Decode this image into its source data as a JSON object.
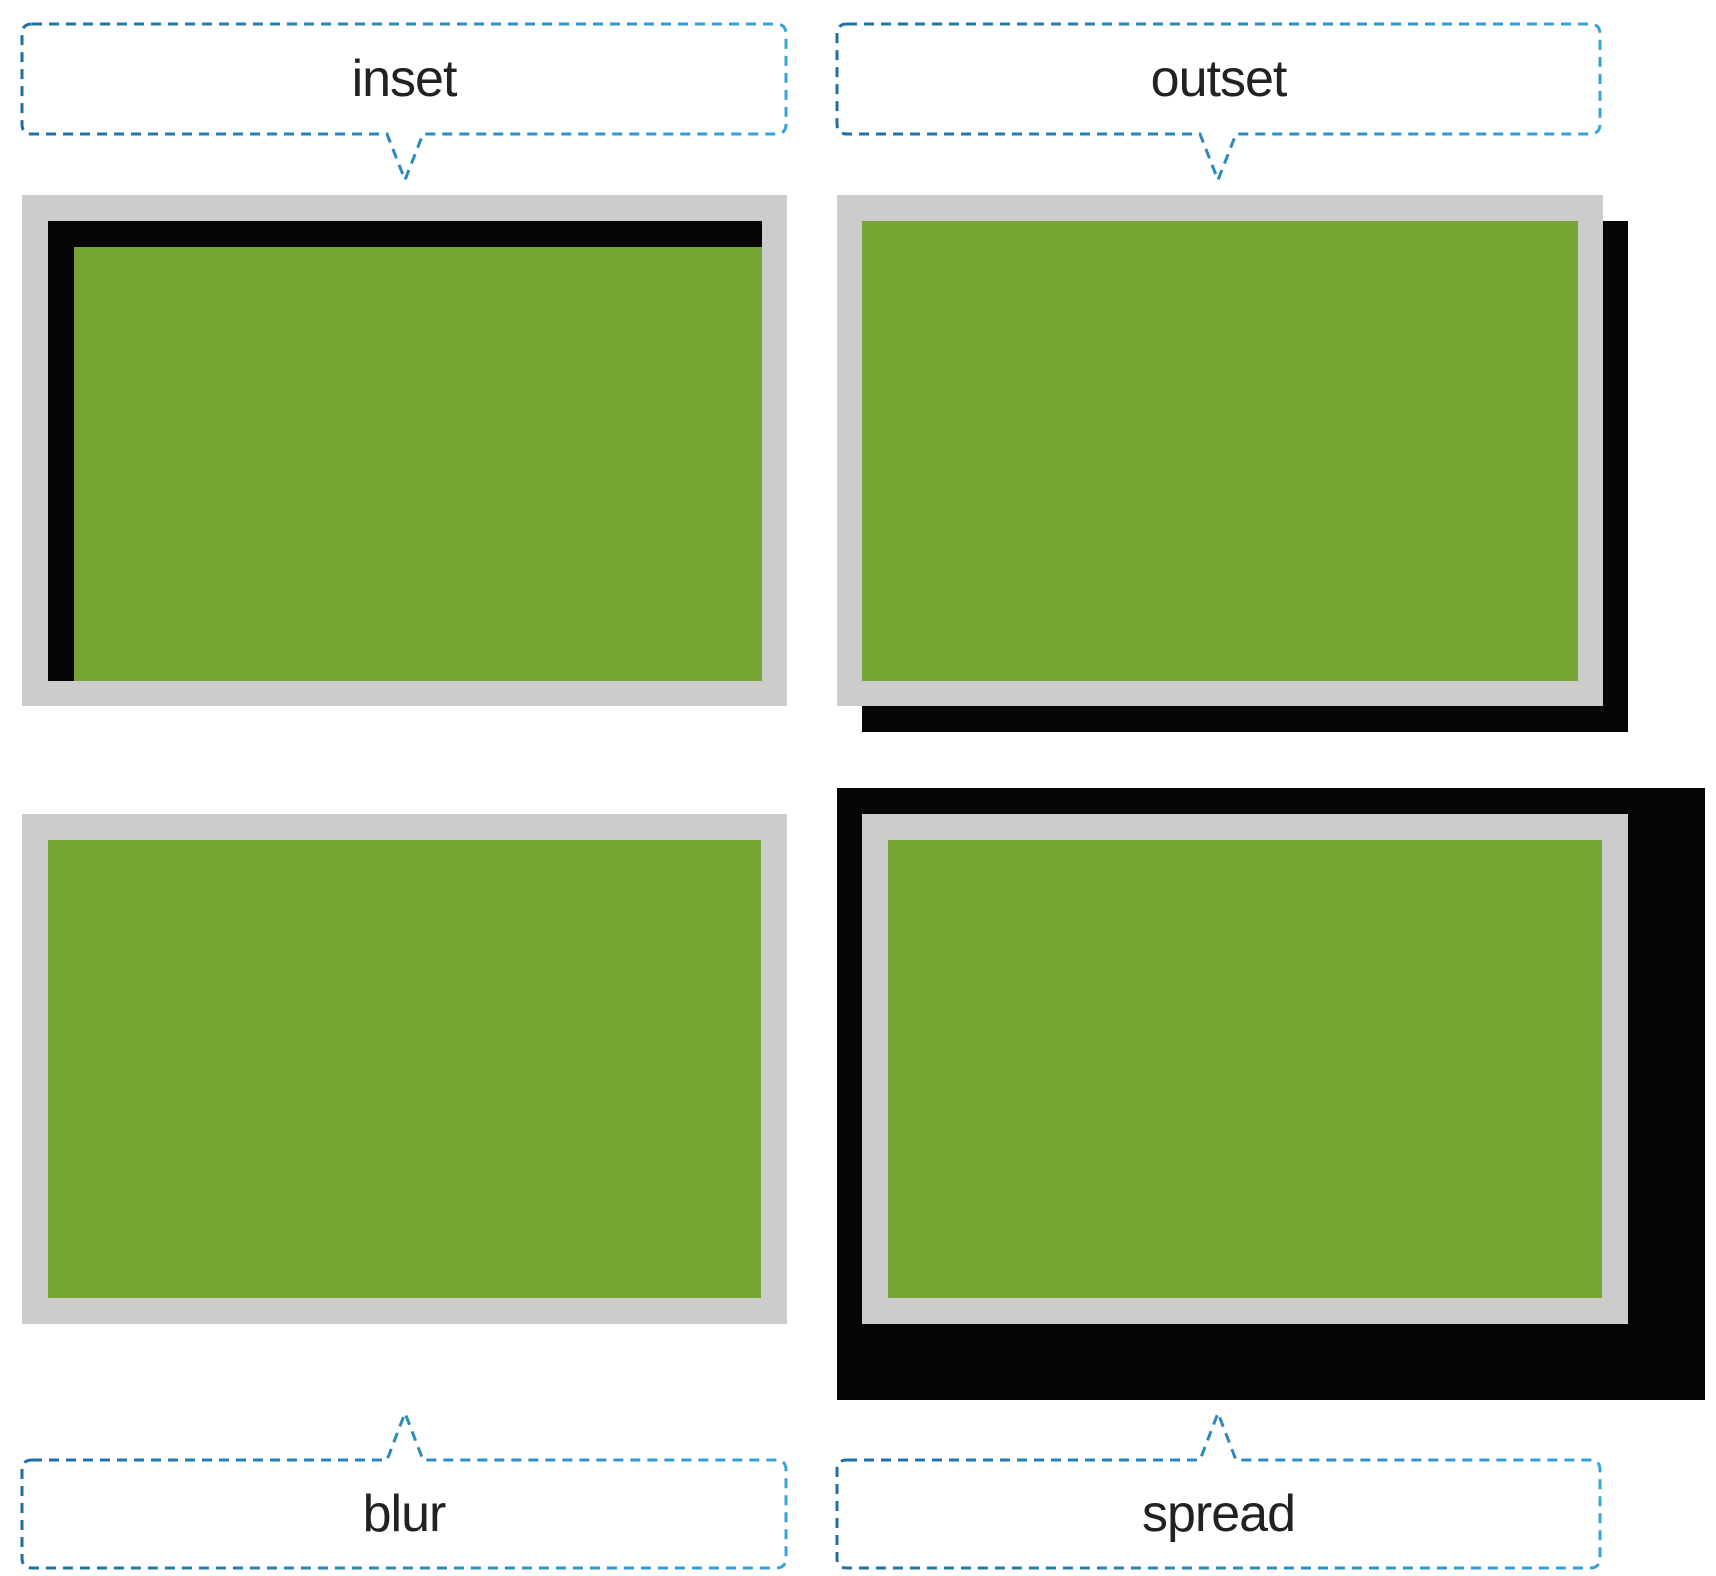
{
  "labels": {
    "inset": "inset",
    "outset": "outset",
    "blur": "blur",
    "spread": "spread"
  },
  "colors": {
    "content": "#76a534",
    "frame": "#cccccc",
    "shadow": "#050505",
    "callout_border_dark": "#1f6fa3",
    "callout_border_light": "#36a4d8",
    "label_text": "#222222"
  }
}
